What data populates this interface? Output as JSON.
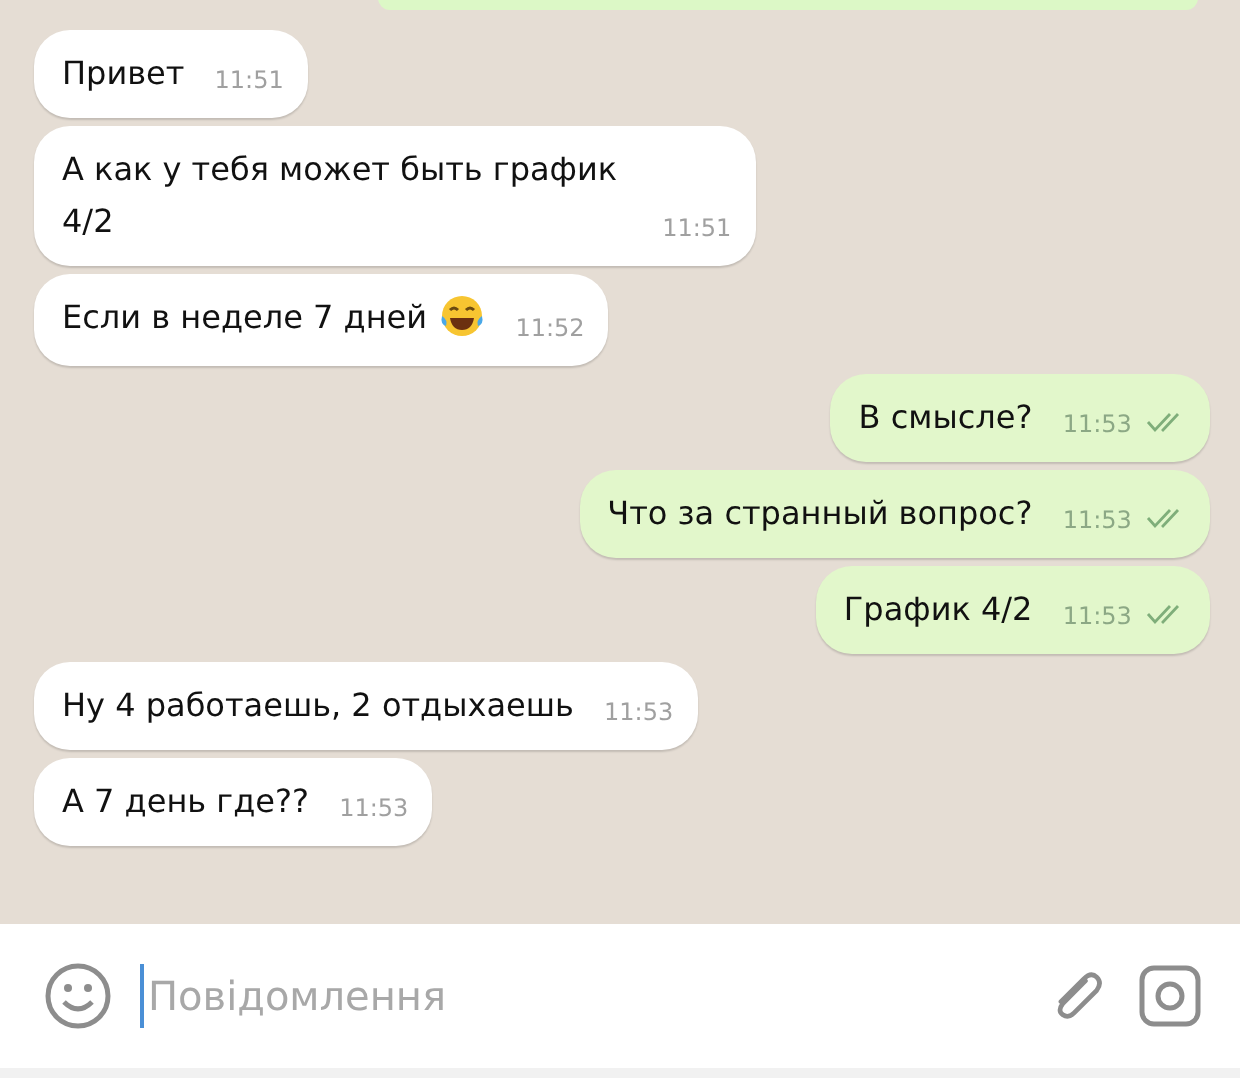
{
  "messages": [
    {
      "kind": "in",
      "text": "Привет",
      "time": "11:51",
      "emoji": false
    },
    {
      "kind": "in",
      "text": "А как у тебя может быть график 4/2",
      "time": "11:51",
      "emoji": false
    },
    {
      "kind": "in",
      "text": "Если в неделе 7 дней",
      "time": "11:52",
      "emoji": true
    },
    {
      "kind": "out",
      "text": "В смысле?",
      "time": "11:53",
      "emoji": false
    },
    {
      "kind": "out",
      "text": "Что за странный вопрос?",
      "time": "11:53",
      "emoji": false
    },
    {
      "kind": "out",
      "text": "График 4/2",
      "time": "11:53",
      "emoji": false
    },
    {
      "kind": "in",
      "text": "Ну 4 работаешь, 2 отдыхаешь",
      "time": "11:53",
      "emoji": false
    },
    {
      "kind": "in",
      "text": "А 7 день где??",
      "time": "11:53",
      "emoji": false
    }
  ],
  "composer": {
    "placeholder": "Повідомлення"
  }
}
